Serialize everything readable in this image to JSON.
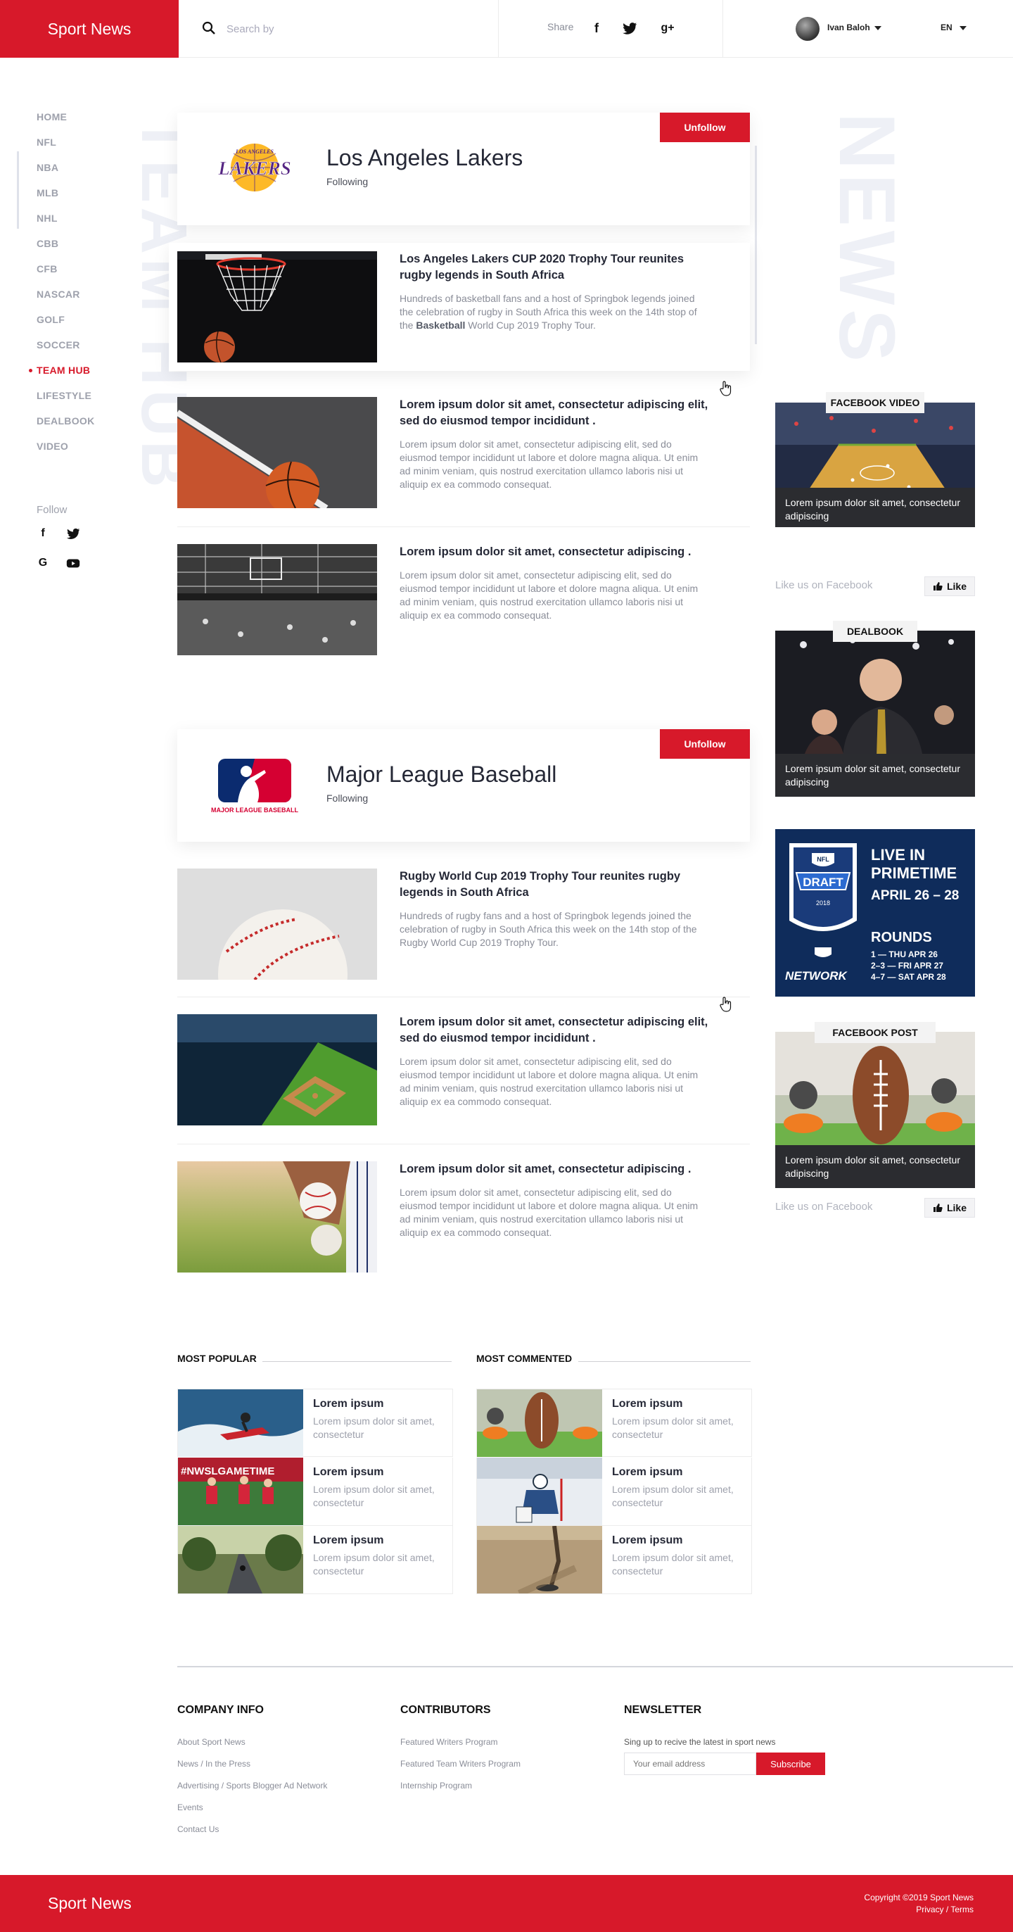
{
  "header": {
    "brand": "Sport News",
    "search_placeholder": "Search by",
    "share_label": "Share",
    "share_icons": [
      "facebook-icon",
      "twitter-icon",
      "google-plus-icon"
    ],
    "user_name": "Ivan Baloh",
    "language": "EN"
  },
  "sidebar": {
    "items": [
      {
        "label": "HOME"
      },
      {
        "label": "NFL"
      },
      {
        "label": "NBA"
      },
      {
        "label": "MLB"
      },
      {
        "label": "NHL"
      },
      {
        "label": "CBB"
      },
      {
        "label": "CFB"
      },
      {
        "label": "NASCAR"
      },
      {
        "label": "GOLF"
      },
      {
        "label": "SOCCER"
      },
      {
        "label": "TEAM HUB",
        "active": true
      },
      {
        "label": "LIFESTYLE"
      },
      {
        "label": "DEALBOOK"
      },
      {
        "label": "VIDEO"
      }
    ],
    "follow_label": "Follow",
    "social_icons": [
      "facebook-icon",
      "twitter-icon",
      "google-icon",
      "youtube-icon"
    ]
  },
  "watermarks": {
    "left": "TEAM HUB",
    "right": "NEWS"
  },
  "teams": [
    {
      "name": "Los Angeles Lakers",
      "status": "Following",
      "button": "Unfollow",
      "logo_text": "LOS ANGELES LAKERS",
      "articles": [
        {
          "title": "Los Angeles Lakers CUP 2020 Trophy Tour reunites rugby legends in South Africa",
          "body_pre": "Hundreds of basketball fans and a host of Springbok legends joined the celebration of rugby in South Africa this week on the 14th stop of the ",
          "body_bold": "Basketball",
          "body_post": " World Cup 2019 Trophy Tour."
        },
        {
          "title": "Lorem ipsum dolor sit amet, consectetur adipiscing elit, sed do eiusmod tempor incididunt .",
          "body": "Lorem ipsum dolor sit amet, consectetur adipiscing elit, sed do eiusmod tempor incididunt ut labore et dolore magna aliqua. Ut enim ad minim veniam, quis nostrud exercitation ullamco laboris nisi ut aliquip ex ea commodo consequat."
        },
        {
          "title": "Lorem ipsum dolor sit amet, consectetur adipiscing .",
          "body": "Lorem ipsum dolor sit amet, consectetur adipiscing elit, sed do eiusmod tempor incididunt ut labore et dolore magna aliqua. Ut enim ad minim veniam, quis nostrud exercitation ullamco laboris nisi ut aliquip ex ea commodo consequat."
        }
      ]
    },
    {
      "name": "Major League Baseball",
      "status": "Following",
      "button": "Unfollow",
      "logo_text": "MAJOR LEAGUE BASEBALL",
      "articles": [
        {
          "title": "Rugby World Cup 2019 Trophy Tour reunites rugby legends in South Africa",
          "body": "Hundreds of rugby fans and a host of Springbok legends joined the celebration of rugby in South Africa this week on the 14th stop of the Rugby World Cup 2019 Trophy Tour."
        },
        {
          "title": "Lorem ipsum dolor sit amet, consectetur adipiscing elit, sed do eiusmod tempor incididunt .",
          "body": "Lorem ipsum dolor sit amet, consectetur adipiscing elit, sed do eiusmod tempor incididunt ut labore et dolore magna aliqua. Ut enim ad minim veniam, quis nostrud exercitation ullamco laboris nisi ut aliquip ex ea commodo consequat."
        },
        {
          "title": "Lorem ipsum dolor sit amet, consectetur adipiscing .",
          "body": "Lorem ipsum dolor sit amet, consectetur adipiscing elit, sed do eiusmod tempor incididunt ut labore et dolore magna aliqua. Ut enim ad minim veniam, quis nostrud exercitation ullamco laboris nisi ut aliquip ex ea commodo consequat."
        }
      ]
    }
  ],
  "right_sidebar": {
    "facebook_video": {
      "tag": "FACEBOOK  VIDEO",
      "caption": "Lorem ipsum dolor sit amet, consectetur adipiscing",
      "like_text": "Like us on Facebook",
      "like_button": "Like"
    },
    "dealbook": {
      "tag": "DEALBOOK",
      "caption": "Lorem ipsum dolor sit amet, consectetur adipiscing"
    },
    "ad": {
      "title_lines": [
        "LIVE IN",
        "PRIMETIME"
      ],
      "dates": "APRIL 26 – 28",
      "rounds_label": "ROUNDS",
      "rounds": [
        "1 — THU APR 26",
        "2–3 — FRI APR 27",
        "4–7 — SAT APR 28"
      ],
      "badge_top": "NFL",
      "badge_main": "DRAFT",
      "badge_year": "2018",
      "network": "NETWORK"
    },
    "facebook_post": {
      "tag": "FACEBOOK POST",
      "caption": "Lorem ipsum dolor sit amet, consectetur adipiscing",
      "like_text": "Like us on Facebook",
      "like_button": "Like"
    }
  },
  "most_popular": {
    "heading": "MOST POPULAR",
    "items": [
      {
        "title": "Lorem ipsum",
        "body": "Lorem ipsum dolor sit amet, consectetur"
      },
      {
        "title": "Lorem ipsum",
        "body": "Lorem ipsum dolor sit amet, consectetur",
        "image_text": "#NWSLGAMETIME"
      },
      {
        "title": "Lorem ipsum",
        "body": "Lorem ipsum dolor sit amet, consectetur"
      }
    ]
  },
  "most_commented": {
    "heading": "MOST COMMENTED",
    "items": [
      {
        "title": "Lorem ipsum",
        "body": "Lorem ipsum dolor sit amet, consectetur"
      },
      {
        "title": "Lorem ipsum",
        "body": "Lorem ipsum dolor sit amet, consectetur"
      },
      {
        "title": "Lorem ipsum",
        "body": "Lorem ipsum dolor sit amet, consectetur"
      }
    ]
  },
  "footer": {
    "company": {
      "heading": "COMPANY INFO",
      "links": [
        "About Sport News",
        "News / In the Press",
        "Advertising / Sports Blogger Ad Network",
        "Events",
        "Contact Us"
      ]
    },
    "contributors": {
      "heading": "CONTRIBUTORS",
      "links": [
        "Featured Writers Program",
        "Featured Team Writers Program",
        "Internship Program"
      ]
    },
    "newsletter": {
      "heading": "NEWSLETTER",
      "text": "Sing up to recive the latest in sport news",
      "placeholder": "Your email address",
      "button": "Subscribe"
    },
    "brand": "Sport News",
    "copyright": "Copyright ©2019 Sport News",
    "legal": "Privacy / Terms"
  },
  "colors": {
    "accent": "#d7192a",
    "text_dark": "#252836",
    "text_muted": "#8a8d98",
    "caption_bg": "#2b2c30"
  }
}
